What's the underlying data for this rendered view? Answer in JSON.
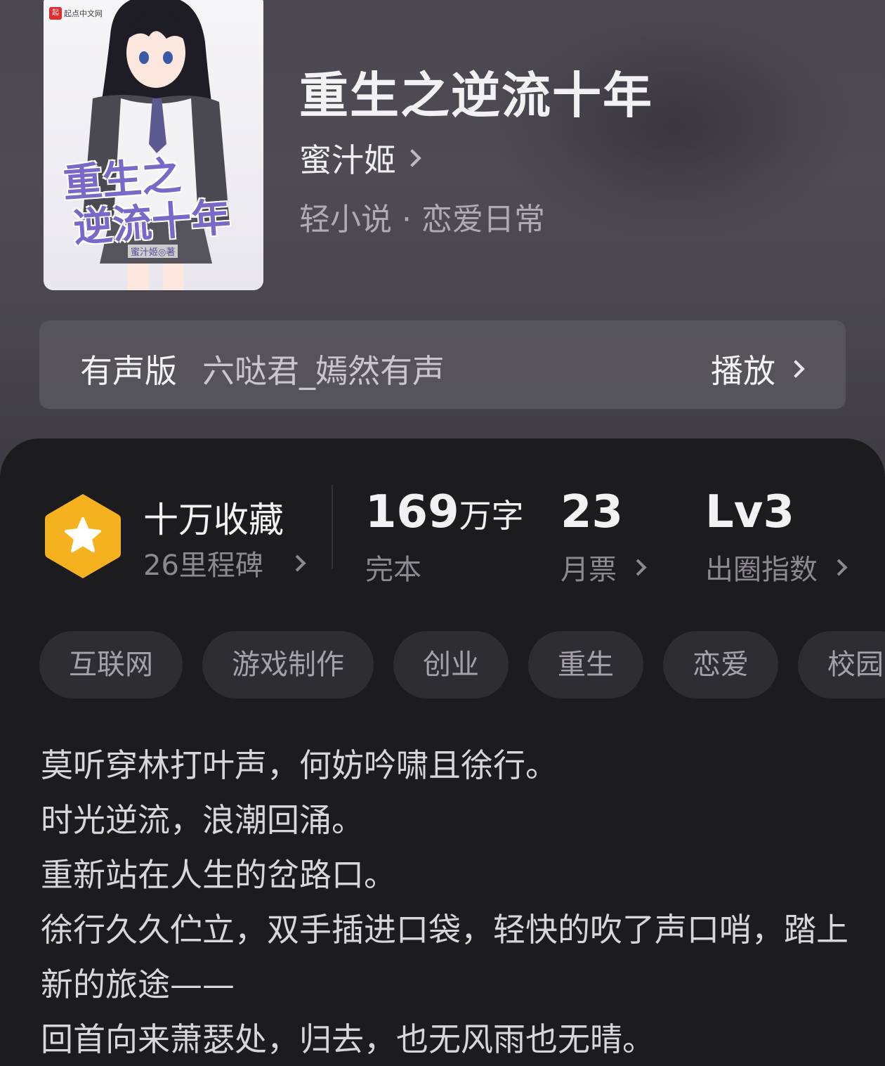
{
  "cover": {
    "logo_text": "起点中文网",
    "title_line1": "重生之",
    "title_line2": "逆流十年",
    "author_mark": "蜜汁姬◎著"
  },
  "book": {
    "title": "重生之逆流十年",
    "author": "蜜汁姬",
    "genre": "轻小说 · 恋爱日常"
  },
  "audio": {
    "label": "有声版",
    "narrator": "六哒君_嫣然有声",
    "play_label": "播放"
  },
  "stats": {
    "collection_title": "十万收藏",
    "milestone": "26里程碑",
    "word_count_number": "169",
    "word_count_unit": "万字",
    "status": "完本",
    "monthly_votes": "23",
    "monthly_votes_label": "月票",
    "level": "Lv3",
    "level_label": "出圈指数"
  },
  "tags": [
    "互联网",
    "游戏制作",
    "创业",
    "重生",
    "恋爱",
    "校园"
  ],
  "intro": [
    "莫听穿林打叶声，何妨吟啸且徐行。",
    "时光逆流，浪潮回涌。",
    "重新站在人生的岔路口。",
    "徐行久久伫立，双手插进口袋，轻快的吹了声口哨，踏上新的旅途——",
    "回首向来萧瑟处，归去，也无风雨也无晴。"
  ],
  "colors": {
    "background": "#1c1b1d",
    "hero": "#4d4a53",
    "badge": "#f5b11e"
  }
}
